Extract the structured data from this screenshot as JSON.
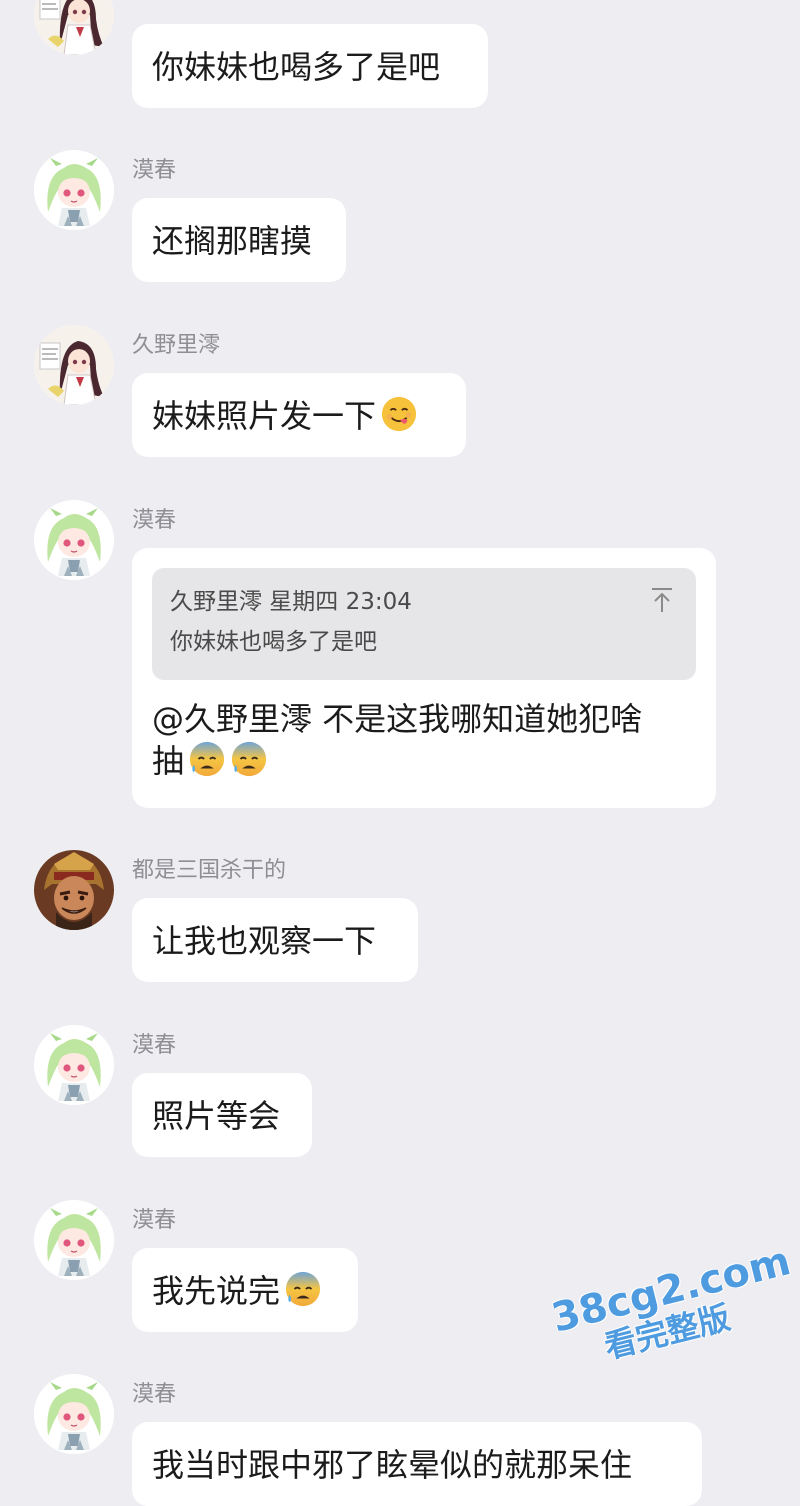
{
  "messages": [
    {
      "sender": "",
      "text": "你妹妹也喝多了是吧",
      "avatar": "anime-girl-dark-hair"
    },
    {
      "sender": "漠春",
      "text": "还搁那瞎摸",
      "avatar": "anime-girl-green-hair"
    },
    {
      "sender": "久野里澪",
      "text": "妹妹照片发一下",
      "emoji": "yum-face-emoji",
      "avatar": "anime-girl-dark-hair"
    },
    {
      "sender": "漠春",
      "avatar": "anime-girl-green-hair",
      "quote": {
        "meta": "久野里澪 星期四 23:04",
        "text": "你妹妹也喝多了是吧",
        "jump_icon": "jump-to-top-icon"
      },
      "line1": "@久野里澪 不是这我哪知道她犯啥",
      "line2": "抽",
      "emoji": "anxious-sweat-face-emoji"
    },
    {
      "sender": "都是三国杀干的",
      "text": "让我也观察一下",
      "avatar": "warrior-helmet-avatar"
    },
    {
      "sender": "漠春",
      "text": "照片等会",
      "avatar": "anime-girl-green-hair"
    },
    {
      "sender": "漠春",
      "text": "我先说完",
      "emoji": "anxious-sweat-face-emoji",
      "avatar": "anime-girl-green-hair"
    },
    {
      "sender": "漠春",
      "text": "我当时跟中邪了眩晕似的就那呆住",
      "avatar": "anime-girl-green-hair"
    }
  ],
  "watermark": {
    "line1": "38cg2.com",
    "line2": "看完整版"
  },
  "colors": {
    "background": "#ededf2",
    "bubble": "#ffffff",
    "quote": "#e6e6e8",
    "sender": "#8e8e93",
    "watermark": "#4e9be0"
  }
}
